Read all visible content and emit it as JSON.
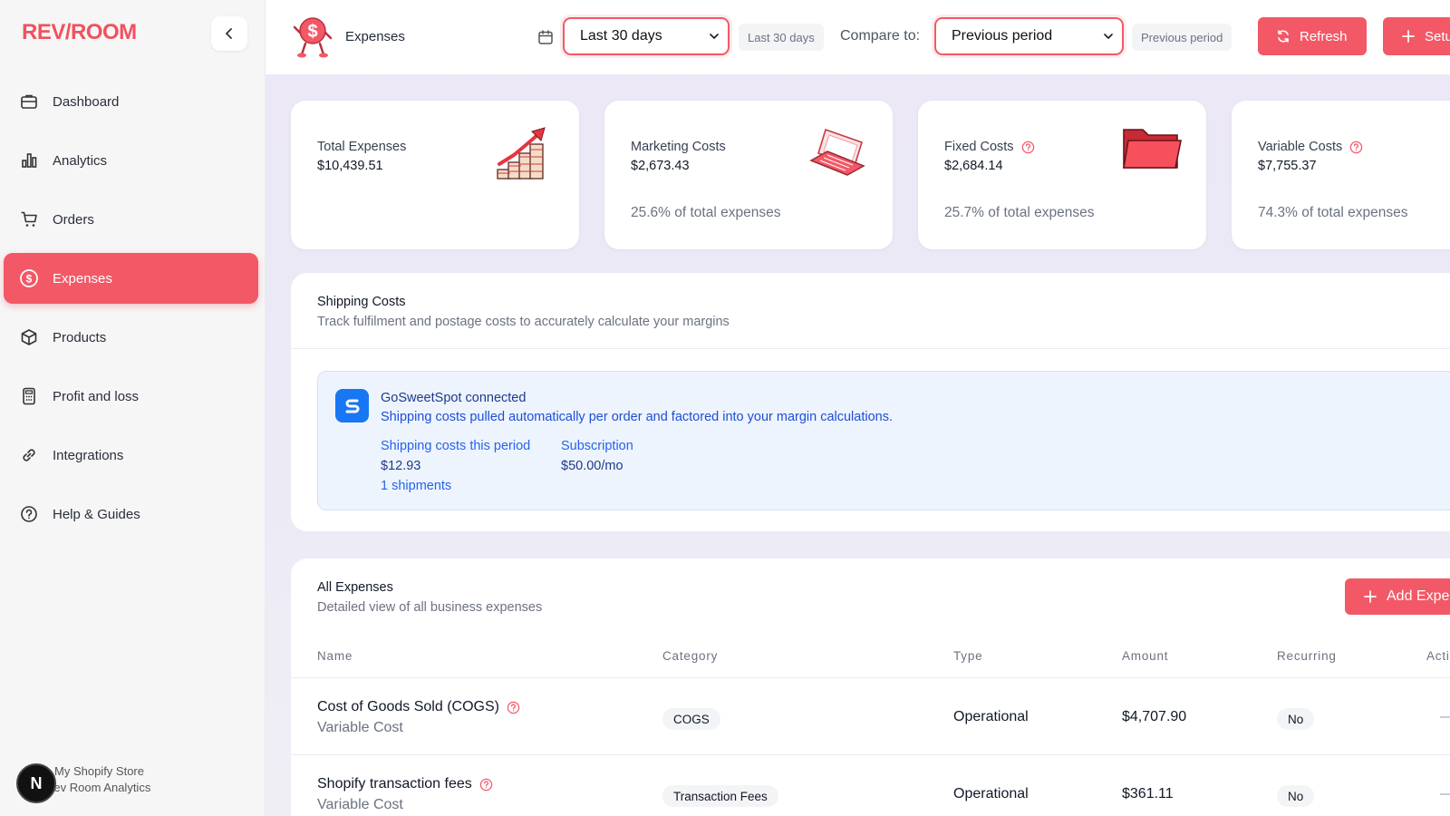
{
  "brand": {
    "logo_text": "REV/ROOM",
    "accent": "#f35866"
  },
  "sidebar": {
    "items": [
      {
        "label": "Dashboard",
        "icon": "briefcase-icon"
      },
      {
        "label": "Analytics",
        "icon": "bar-chart-icon"
      },
      {
        "label": "Orders",
        "icon": "cart-icon"
      },
      {
        "label": "Expenses",
        "icon": "dollar-circle-icon",
        "active": true
      },
      {
        "label": "Products",
        "icon": "box-icon"
      },
      {
        "label": "Profit and loss",
        "icon": "calculator-icon"
      },
      {
        "label": "Integrations",
        "icon": "link-icon"
      },
      {
        "label": "Help & Guides",
        "icon": "help-circle-icon"
      }
    ],
    "store": {
      "avatar_letter": "N",
      "line1": "My Shopify Store",
      "line2": "Rev Room Analytics"
    }
  },
  "header": {
    "title": "Expenses",
    "date_range": "Last 30 days",
    "date_range_chip": "Last 30 days",
    "compare_label": "Compare to:",
    "compare_value": "Previous period",
    "compare_chip": "Previous period",
    "refresh_label": "Refresh",
    "setup_label": "Setu"
  },
  "cards": [
    {
      "label": "Total Expenses",
      "value": "$10,439.51",
      "pct": "",
      "help": false
    },
    {
      "label": "Marketing Costs",
      "value": "$2,673.43",
      "pct": "25.6% of total expenses",
      "help": false
    },
    {
      "label": "Fixed Costs",
      "value": "$2,684.14",
      "pct": "25.7% of total expenses",
      "help": true
    },
    {
      "label": "Variable Costs",
      "value": "$7,755.37",
      "pct": "74.3% of total expenses",
      "help": true
    }
  ],
  "shipping": {
    "title": "Shipping Costs",
    "subtitle": "Track fulfilment and postage costs to accurately calculate your margins",
    "provider_title": "GoSweetSpot connected",
    "provider_desc": "Shipping costs pulled automatically per order and factored into your margin calculations.",
    "period_label": "Shipping costs this period",
    "period_value": "$12.93",
    "shipments": "1 shipments",
    "subscription_label": "Subscription",
    "subscription_value": "$50.00/mo"
  },
  "expenses": {
    "title": "All Expenses",
    "subtitle": "Detailed view of all business expenses",
    "add_label": "Add Expe",
    "columns": [
      "Name",
      "Category",
      "Type",
      "Amount",
      "Recurring",
      "Actio"
    ],
    "rows": [
      {
        "name": "Cost of Goods Sold (COGS)",
        "sub": "Variable Cost",
        "category": "COGS",
        "type": "Operational",
        "amount": "$4,707.90",
        "recurring": "No",
        "action": "—"
      },
      {
        "name": "Shopify transaction fees",
        "sub": "Variable Cost",
        "category": "Transaction Fees",
        "type": "Operational",
        "amount": "$361.11",
        "recurring": "No",
        "action": "—"
      }
    ]
  }
}
